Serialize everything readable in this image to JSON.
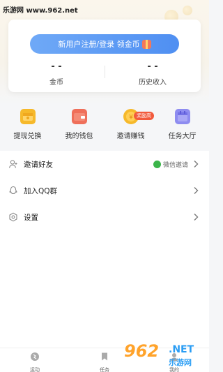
{
  "watermark": {
    "site": "乐游网 www.962.net"
  },
  "account": {
    "login_label": "新用户注册/登录 领金币",
    "coins_value": "- -",
    "coins_label": "金币",
    "history_value": "- -",
    "history_label": "历史收入"
  },
  "quick_actions": [
    {
      "label": "提现兑换",
      "icon": "wallet-coin-icon",
      "color": "#f6b92b"
    },
    {
      "label": "我的钱包",
      "icon": "wallet-icon",
      "color": "#ef6f5a"
    },
    {
      "label": "邀请赚钱",
      "icon": "invite-coin-icon",
      "color": "#f6b92b",
      "badge": "奖励高"
    },
    {
      "label": "任务大厅",
      "icon": "calendar-icon",
      "color": "#8e8cf0"
    }
  ],
  "menu": [
    {
      "label": "邀请好友",
      "icon": "person-add-icon",
      "tag": "微信邀请"
    },
    {
      "label": "加入QQ群",
      "icon": "qq-icon"
    },
    {
      "label": "设置",
      "icon": "gear-icon"
    }
  ],
  "tabbar": {
    "tabs": [
      {
        "label": "运动",
        "icon": "run-icon"
      },
      {
        "label": "任务",
        "icon": "flag-icon"
      },
      {
        "label": "我的",
        "icon": "profile-icon"
      }
    ]
  },
  "logo": {
    "num": "962",
    "net": ".NET",
    "cn": "乐游网"
  },
  "colors": {
    "accent": "#4f8ff2",
    "badge": "#f25a3c",
    "wechat": "#3bb54a"
  }
}
